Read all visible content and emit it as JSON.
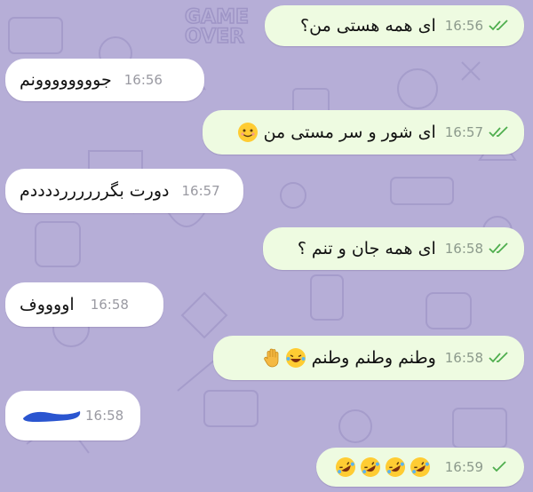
{
  "colors": {
    "wallpaper": "#b6aed7",
    "outgoing_bubble": "#eefbe1",
    "incoming_bubble": "#ffffff",
    "checkmark": "#4fae4e",
    "time": "#8c9a8c"
  },
  "wallpaper_text": [
    "GAME",
    "OVER"
  ],
  "messages": [
    {
      "dir": "out",
      "text": "ای همه هستی من؟",
      "time": "16:56",
      "status": "read"
    },
    {
      "dir": "in",
      "text": "جوووووووونم",
      "time": "16:56"
    },
    {
      "dir": "out",
      "text": "ای شور و سر مستی من",
      "emoji": [
        "smiling-face-emoji"
      ],
      "time": "16:57",
      "status": "read"
    },
    {
      "dir": "in",
      "text": "دورت بگررررررددددم",
      "time": "16:57"
    },
    {
      "dir": "out",
      "text": "ای همه جان و تنم ؟",
      "time": "16:58",
      "status": "read"
    },
    {
      "dir": "in",
      "text": "اووووف",
      "time": "16:58"
    },
    {
      "dir": "out",
      "text": "وطنم وطنم وطنم",
      "emoji": [
        "laughing-crying-emoji",
        "raised-hand-emoji"
      ],
      "time": "16:58",
      "status": "read"
    },
    {
      "dir": "in",
      "text": "",
      "redacted": true,
      "time": "16:58"
    },
    {
      "dir": "out",
      "text": "",
      "emoji": [
        "rofl-emoji",
        "rofl-emoji",
        "rofl-emoji",
        "rofl-emoji"
      ],
      "time": "16:59",
      "status": "sent"
    }
  ]
}
